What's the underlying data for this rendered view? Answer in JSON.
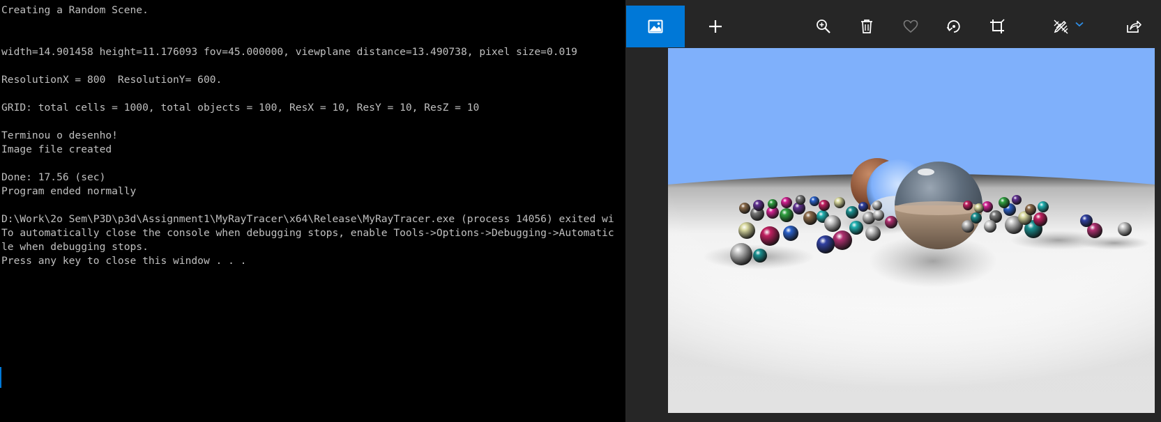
{
  "console": {
    "lines": [
      "Creating a Random Scene.",
      "",
      "",
      "width=14.901458 height=11.176093 fov=45.000000, viewplane distance=13.490738, pixel size=0.019",
      "",
      "ResolutionX = 800  ResolutionY= 600.",
      "",
      "GRID: total cells = 1000, total objects = 100, ResX = 10, ResY = 10, ResZ = 10",
      "",
      "Terminou o desenho!",
      "Image file created",
      "",
      "Done: 17.56 (sec)",
      "Program ended normally",
      "",
      "D:\\Work\\2o Sem\\P3D\\p3d\\Assignment1\\MyRayTracer\\x64\\Release\\MyRayTracer.exe (process 14056) exited wi",
      "To automatically close the console when debugging stops, enable Tools->Options->Debugging->Automatic",
      "le when debugging stops.",
      "Press any key to close this window . . ."
    ]
  },
  "photos_toolbar": {
    "buttons": [
      {
        "id": "view",
        "icon": "picture-icon"
      },
      {
        "id": "add",
        "icon": "plus-icon"
      },
      {
        "id": "zoom",
        "icon": "zoom-in-icon"
      },
      {
        "id": "delete",
        "icon": "trash-icon"
      },
      {
        "id": "favorite",
        "icon": "heart-icon"
      },
      {
        "id": "rotate",
        "icon": "rotate-icon"
      },
      {
        "id": "crop",
        "icon": "crop-icon"
      },
      {
        "id": "edit",
        "icon": "edit-draw-icon"
      },
      {
        "id": "share",
        "icon": "share-icon"
      }
    ]
  },
  "colors": {
    "accent": "#0078d7",
    "console_bg": "#000000",
    "console_text": "#c0c0c0",
    "app_bg": "#262626",
    "sky": "#7fb0fb"
  }
}
